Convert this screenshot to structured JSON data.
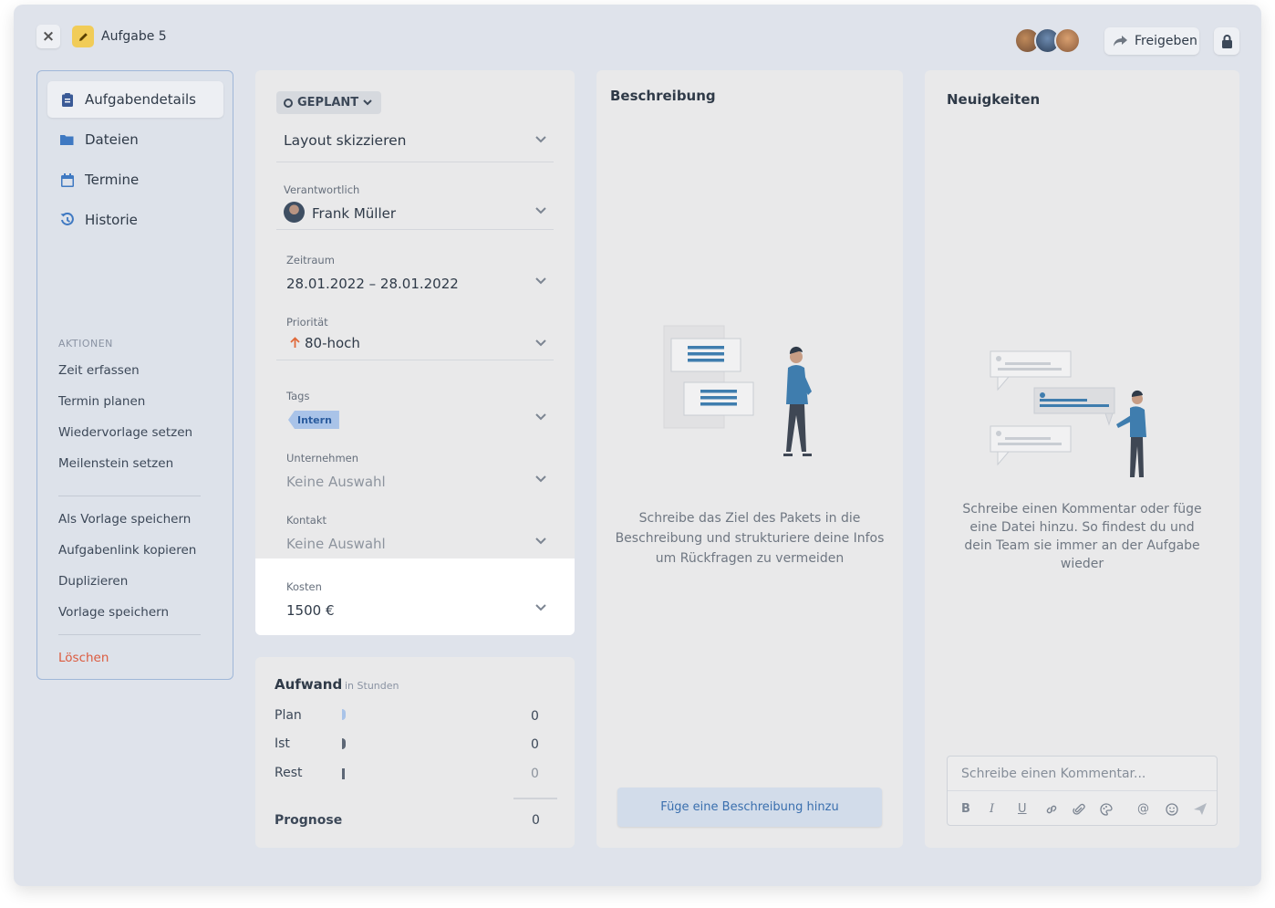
{
  "header": {
    "close_label": "×",
    "task_title": "Aufgabe 5",
    "share_label": "Freigeben"
  },
  "sidebar": {
    "nav": [
      {
        "label": "Aufgabendetails",
        "icon": "clipboard-icon"
      },
      {
        "label": "Dateien",
        "icon": "folder-icon"
      },
      {
        "label": "Termine",
        "icon": "calendar-icon"
      },
      {
        "label": "Historie",
        "icon": "history-icon"
      }
    ],
    "actions_heading": "AKTIONEN",
    "actions": [
      "Zeit erfassen",
      "Termin planen",
      "Wiedervorlage setzen",
      "Meilenstein setzen"
    ],
    "more_actions": [
      "Als Vorlage speichern",
      "Aufgabenlink kopieren",
      "Duplizieren",
      "Vorlage speichern"
    ],
    "delete_label": "Löschen"
  },
  "details": {
    "status": "GEPLANT",
    "task_name": "Layout skizzieren",
    "responsible_label": "Verantwortlich",
    "responsible_value": "Frank Müller",
    "period_label": "Zeitraum",
    "period_value": "28.01.2022 – 28.01.2022",
    "priority_label": "Priorität",
    "priority_value": "80-hoch",
    "tags_label": "Tags",
    "tag_value": "Intern",
    "company_label": "Unternehmen",
    "company_value": "Keine Auswahl",
    "contact_label": "Kontakt",
    "contact_value": "Keine Auswahl",
    "cost_label": "Kosten",
    "cost_value": "1500 €"
  },
  "effort": {
    "title": "Aufwand",
    "unit": "in Stunden",
    "rows": [
      {
        "label": "Plan",
        "value": "0"
      },
      {
        "label": "Ist",
        "value": "0"
      },
      {
        "label": "Rest",
        "value": "0"
      }
    ],
    "forecast_label": "Prognose",
    "forecast_value": "0"
  },
  "description": {
    "title": "Beschreibung",
    "empty_text": "Schreibe das Ziel des Pakets in die Beschreibung und strukturiere deine Infos um Rückfragen zu vermeiden",
    "add_button": "Füge eine Beschreibung hinzu"
  },
  "news": {
    "title": "Neuigkeiten",
    "empty_text": "Schreibe einen Kommentar oder füge eine Datei hinzu. So findest du und dein Team sie immer an der Aufgabe wieder",
    "comment_placeholder": "Schreibe einen Kommentar...",
    "toolbar": {
      "bold": "B",
      "italic": "I",
      "underline": "U",
      "mention": "@"
    }
  },
  "colors": {
    "accent": "#3a6fae",
    "status_pill": "#d6d9de",
    "danger": "#dc5b3f",
    "tag_bg": "#a9c3e8",
    "priority_arrow": "#e06a3b"
  }
}
